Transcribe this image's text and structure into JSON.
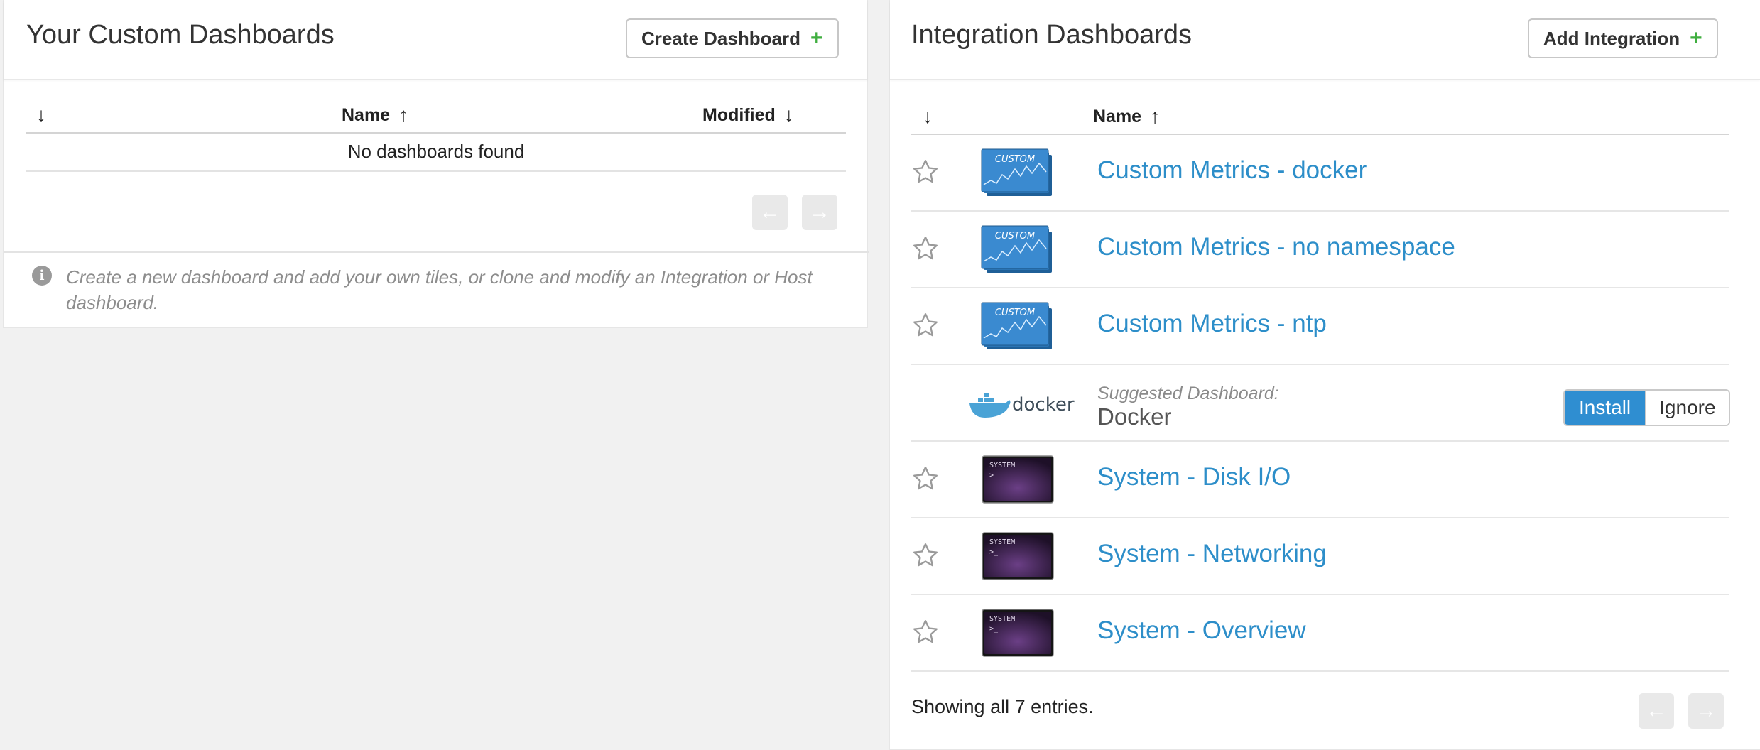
{
  "custom": {
    "title": "Your Custom Dashboards",
    "create_label": "Create Dashboard",
    "plus": "+",
    "columns": {
      "sort": "↓",
      "name": "Name",
      "name_arrow": "↑",
      "modified": "Modified",
      "modified_arrow": "↓"
    },
    "empty_text": "No dashboards found",
    "pager": {
      "prev": "←",
      "next": "→"
    },
    "info_icon": "i",
    "info_text": "Create a new dashboard and add your own tiles, or clone and modify an Integration or Host dashboard."
  },
  "integration": {
    "title": "Integration Dashboards",
    "add_label": "Add Integration",
    "plus": "+",
    "columns": {
      "sort": "↓",
      "name": "Name",
      "name_arrow": "↑"
    },
    "rows": [
      {
        "kind": "custom",
        "label": "Custom Metrics - docker",
        "thumb_text": "CUSTOM"
      },
      {
        "kind": "custom",
        "label": "Custom Metrics - no namespace",
        "thumb_text": "CUSTOM"
      },
      {
        "kind": "custom",
        "label": "Custom Metrics - ntp",
        "thumb_text": "CUSTOM"
      },
      {
        "kind": "suggested",
        "suggest_label": "Suggested Dashboard:",
        "label": "Docker",
        "logo_text": "docker",
        "install": "Install",
        "ignore": "Ignore"
      },
      {
        "kind": "system",
        "label": "System - Disk I/O",
        "thumb_text": "SYSTEM",
        "prompt": ">_"
      },
      {
        "kind": "system",
        "label": "System - Networking",
        "thumb_text": "SYSTEM",
        "prompt": ">_"
      },
      {
        "kind": "system",
        "label": "System - Overview",
        "thumb_text": "SYSTEM",
        "prompt": ">_"
      }
    ],
    "footer_text": "Showing all 7 entries.",
    "pager": {
      "prev": "←",
      "next": "→"
    }
  },
  "colors": {
    "link": "#2d8ec9",
    "install": "#2f8ed1",
    "plus": "#3fae3f"
  }
}
